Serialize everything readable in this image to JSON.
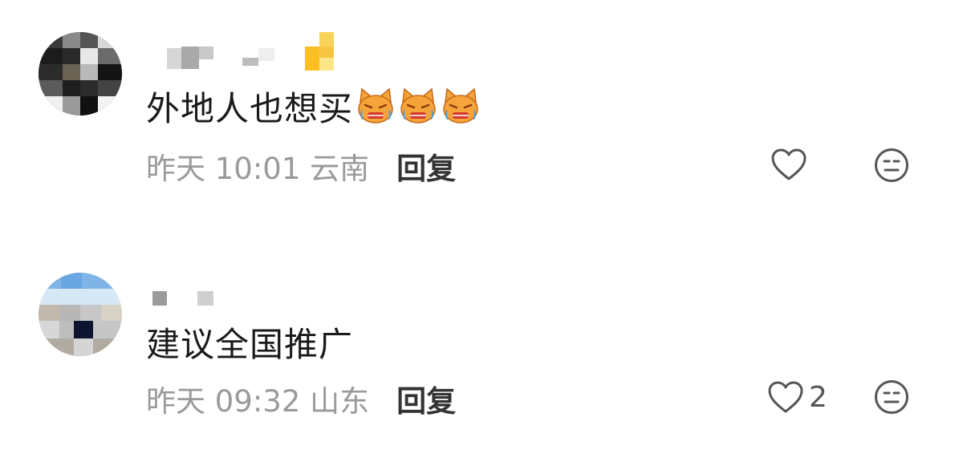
{
  "comments": [
    {
      "text": "外地人也想买",
      "emojis": [
        "crying-cat-emoji",
        "crying-cat-emoji",
        "crying-cat-emoji"
      ],
      "time": "昨天 10:01 云南",
      "reply_label": "回复",
      "like_count": "",
      "username_blurred": true,
      "avatar_blurred": true
    },
    {
      "text": "建议全国推广",
      "emojis": [],
      "time": "昨天 09:32 山东",
      "reply_label": "回复",
      "like_count": "2",
      "username_blurred": true,
      "avatar_blurred": true
    }
  ],
  "icons": {
    "like": "heart-outline-icon",
    "dislike": "meh-face-icon"
  },
  "colors": {
    "text_primary": "#1a1a1a",
    "text_meta": "#9a9a9a",
    "reply": "#333333",
    "icon": "#555555",
    "emoji_cat": "#f4a43a"
  }
}
